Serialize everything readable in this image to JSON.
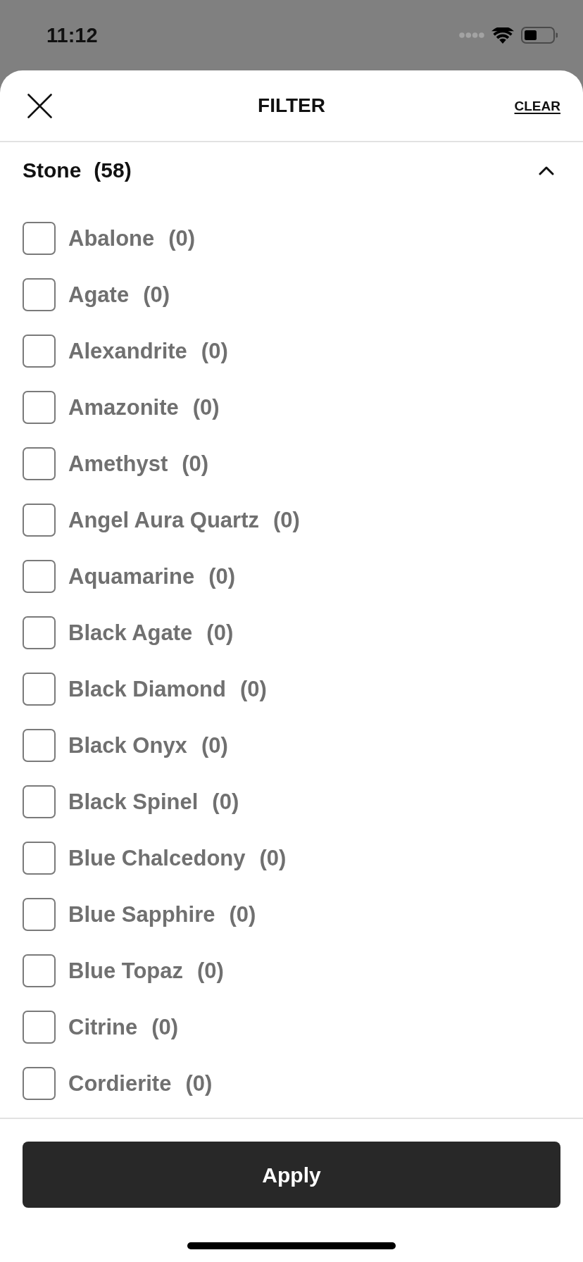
{
  "status_bar": {
    "time": "11:12"
  },
  "header": {
    "title": "FILTER",
    "clear_label": "CLEAR"
  },
  "section": {
    "title": "Stone",
    "count": "(58)",
    "expanded": true,
    "options": [
      {
        "name": "Abalone",
        "count": "(0)",
        "checked": false
      },
      {
        "name": "Agate",
        "count": "(0)",
        "checked": false
      },
      {
        "name": "Alexandrite",
        "count": "(0)",
        "checked": false
      },
      {
        "name": "Amazonite",
        "count": "(0)",
        "checked": false
      },
      {
        "name": "Amethyst",
        "count": "(0)",
        "checked": false
      },
      {
        "name": "Angel Aura Quartz",
        "count": "(0)",
        "checked": false
      },
      {
        "name": "Aquamarine",
        "count": "(0)",
        "checked": false
      },
      {
        "name": "Black Agate",
        "count": "(0)",
        "checked": false
      },
      {
        "name": "Black Diamond",
        "count": "(0)",
        "checked": false
      },
      {
        "name": "Black Onyx",
        "count": "(0)",
        "checked": false
      },
      {
        "name": "Black Spinel",
        "count": "(0)",
        "checked": false
      },
      {
        "name": "Blue Chalcedony",
        "count": "(0)",
        "checked": false
      },
      {
        "name": "Blue Sapphire",
        "count": "(0)",
        "checked": false
      },
      {
        "name": "Blue Topaz",
        "count": "(0)",
        "checked": false
      },
      {
        "name": "Citrine",
        "count": "(0)",
        "checked": false
      },
      {
        "name": "Cordierite",
        "count": "(0)",
        "checked": false
      }
    ]
  },
  "apply_button": "Apply"
}
